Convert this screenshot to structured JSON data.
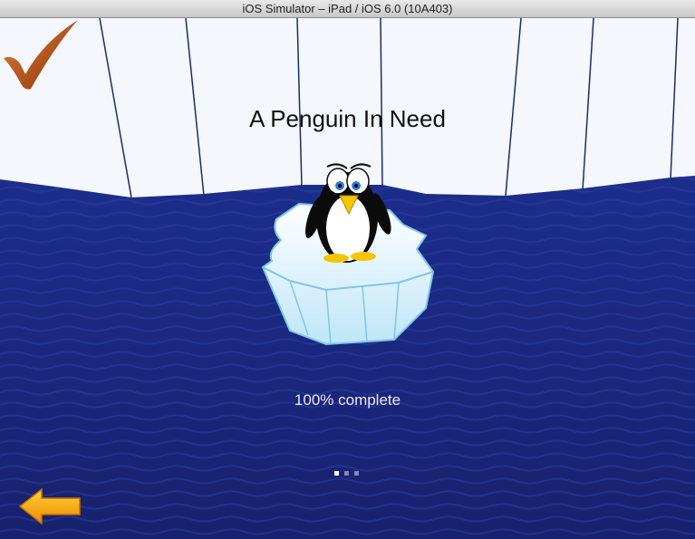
{
  "window": {
    "title": "iOS Simulator – iPad / iOS 6.0 (10A403)"
  },
  "screen": {
    "title": "A Penguin In Need",
    "progress_text": "100% complete",
    "progress_value": 1.0,
    "page_dots": {
      "count": 3,
      "current_index": 0
    },
    "back_button_icon": "left-arrow-icon",
    "completion_icon": "checkmark-icon"
  },
  "colors": {
    "ocean": "#1b2a8a",
    "ice_wall": "#f3f6fb",
    "arrow_fill": "#f7b316",
    "checkmark": "#b04a12"
  }
}
